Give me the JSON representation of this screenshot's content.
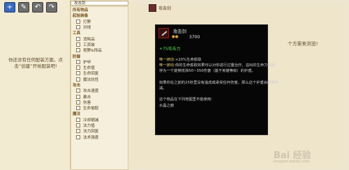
{
  "toolbar": {
    "add_label": "+",
    "edit_label": "✎",
    "undo_label": "↶",
    "redo_label": "↷"
  },
  "left_panel": {
    "message": "你还没有任何配装方案。点击“创建”开始配装吧!"
  },
  "search": {
    "value": "攻击剑"
  },
  "item_list": {
    "rows": [
      {
        "type": "header",
        "label": "所有物品"
      },
      {
        "type": "header",
        "label": "起始装备"
      },
      {
        "type": "item",
        "label": "打野"
      },
      {
        "type": "item",
        "label": "对线"
      },
      {
        "type": "header",
        "label": "工具"
      },
      {
        "type": "item",
        "label": "消耗品"
      },
      {
        "type": "item",
        "label": "工资装"
      },
      {
        "type": "item",
        "label": "视野&饰品"
      },
      {
        "type": "header",
        "label": "防御"
      },
      {
        "type": "item",
        "label": "护甲"
      },
      {
        "type": "item",
        "label": "生命值"
      },
      {
        "type": "item",
        "label": "生命回复"
      },
      {
        "type": "item",
        "label": "魔法抗性"
      },
      {
        "type": "header",
        "label": "攻击"
      },
      {
        "type": "item",
        "label": "攻击速度"
      },
      {
        "type": "item",
        "label": "暴击"
      },
      {
        "type": "item",
        "label": "伤害"
      },
      {
        "type": "item",
        "label": "生命偷取"
      },
      {
        "type": "header",
        "label": "魔法"
      },
      {
        "type": "item",
        "label": "冷却缩减"
      },
      {
        "type": "item",
        "label": "法力值"
      },
      {
        "type": "item",
        "label": "法力回复"
      },
      {
        "type": "item",
        "label": "法术强度"
      }
    ]
  },
  "main": {
    "title": "攻击剑",
    "hint": "个方案来浏览!"
  },
  "tooltip": {
    "name": "攻击剑",
    "coin_icon": "gold-coin-icon",
    "price": "3700",
    "stat": "+75攻击力",
    "lines": [
      {
        "tag": "唯一被动:",
        "text": "+20%生命偷取"
      },
      {
        "tag": "唯一被动:",
        "text": "你的生命偷取效果可以对你进行过量治疗。溢出的生命力会储"
      },
      {
        "tag": "",
        "text": "存为一个能够抵挡50~350伤害（基于英雄等级）的护盾。"
      },
      {
        "tag": "",
        "text": ""
      },
      {
        "tag": "",
        "text": "如果你在之前的25秒里没有造成或承受任何伤害，那么这个护盾会缓慢衰"
      },
      {
        "tag": "",
        "text": "减。"
      },
      {
        "tag": "",
        "text": ""
      },
      {
        "tag": "",
        "text": "这个物品在下列地图里不能使用："
      },
      {
        "tag": "",
        "text": "水晶之痕"
      }
    ]
  },
  "watermark": {
    "main": "Bai 经验",
    "sub": "jingyan.baidu.com"
  },
  "colors": {
    "background": "#efe6cf",
    "tooltip_bg": "#060606",
    "stat_green": "#5fd65f",
    "passive_tag": "#e0c36a"
  }
}
